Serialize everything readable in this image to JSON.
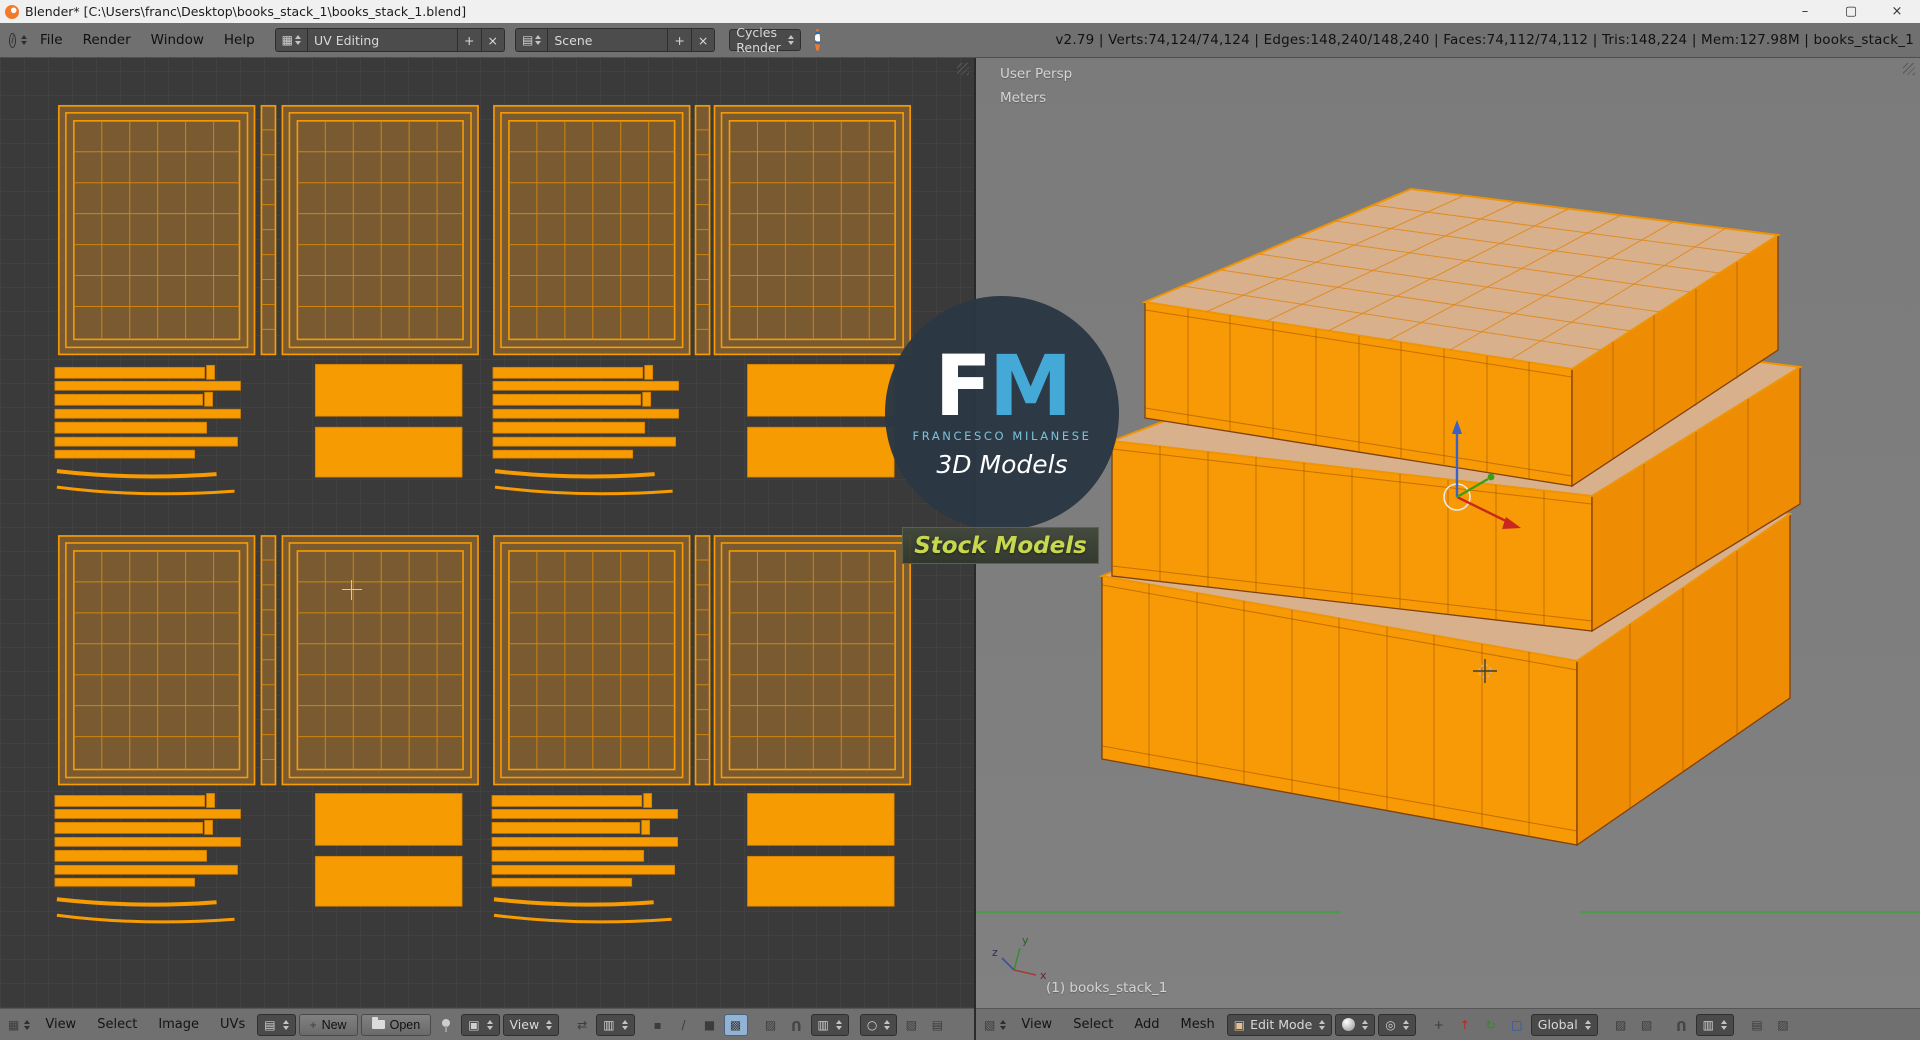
{
  "window": {
    "title": "Blender* [C:\\Users\\franc\\Desktop\\books_stack_1\\books_stack_1.blend]",
    "controls": {
      "minimize": "–",
      "maximize": "▢",
      "close": "×"
    }
  },
  "infobar": {
    "menus": [
      "File",
      "Render",
      "Window",
      "Help"
    ],
    "layout": {
      "value": "UV Editing",
      "add": "+",
      "close": "×"
    },
    "scene": {
      "value": "Scene",
      "add": "+",
      "close": "×"
    },
    "engine": {
      "value": "Cycles Render"
    },
    "stats": "v2.79 | Verts:74,124/74,124 | Edges:148,240/148,240 | Faces:74,112/74,112 | Tris:148,224 | Mem:127.98M | books_stack_1"
  },
  "uv_editor": {
    "menus": [
      "View",
      "Select",
      "Image",
      "UVs"
    ],
    "new_button": "New",
    "open_button": "Open",
    "view_combo": "View"
  },
  "viewport": {
    "persp_label": "User Persp",
    "units_label": "Meters",
    "object_label": "(1) books_stack_1",
    "menus": [
      "View",
      "Select",
      "Add",
      "Mesh"
    ],
    "mode_combo": "Edit Mode",
    "orientation_combo": "Global",
    "axis_labels": {
      "x": "x",
      "y": "y",
      "z": "z"
    }
  },
  "watermark": {
    "f": "F",
    "m": "M",
    "name": "FRANCESCO MILANESE",
    "subtitle": "3D Models",
    "badge": "Stock Models"
  },
  "icons": {
    "info": "i",
    "editor_uv": "▦",
    "editor_3d": "▧",
    "image": "▤",
    "plus": "+",
    "sync": "⇄",
    "sticky": "▥",
    "vertex_mode": "▪",
    "edge_mode": "/",
    "face_mode": "■",
    "island_mode": "▩",
    "magnet": "U",
    "snap_element": "▥",
    "proportional": "○",
    "mode": "▣",
    "pivot": "◎",
    "pointer": "+",
    "translate_arrow": "↑",
    "rotate_arrow": "↻",
    "scale_box": "□",
    "toggle_a": "▨",
    "toggle_b": "▤",
    "toggle_c": "▧"
  },
  "colors": {
    "accent_orange": "#f79b02",
    "uv_island_fill": "#7a5b31",
    "selected_face_tan": "#d8b18c",
    "viewport_bg": "#7d7d7d",
    "uv_bg": "#3a3a3a",
    "header_bg": "#707070",
    "titlebar_bg": "#f0f0f0",
    "logo_blue": "#45a9d8",
    "badge_green": "#c8d84e",
    "axis_green": "#3aa33a"
  }
}
